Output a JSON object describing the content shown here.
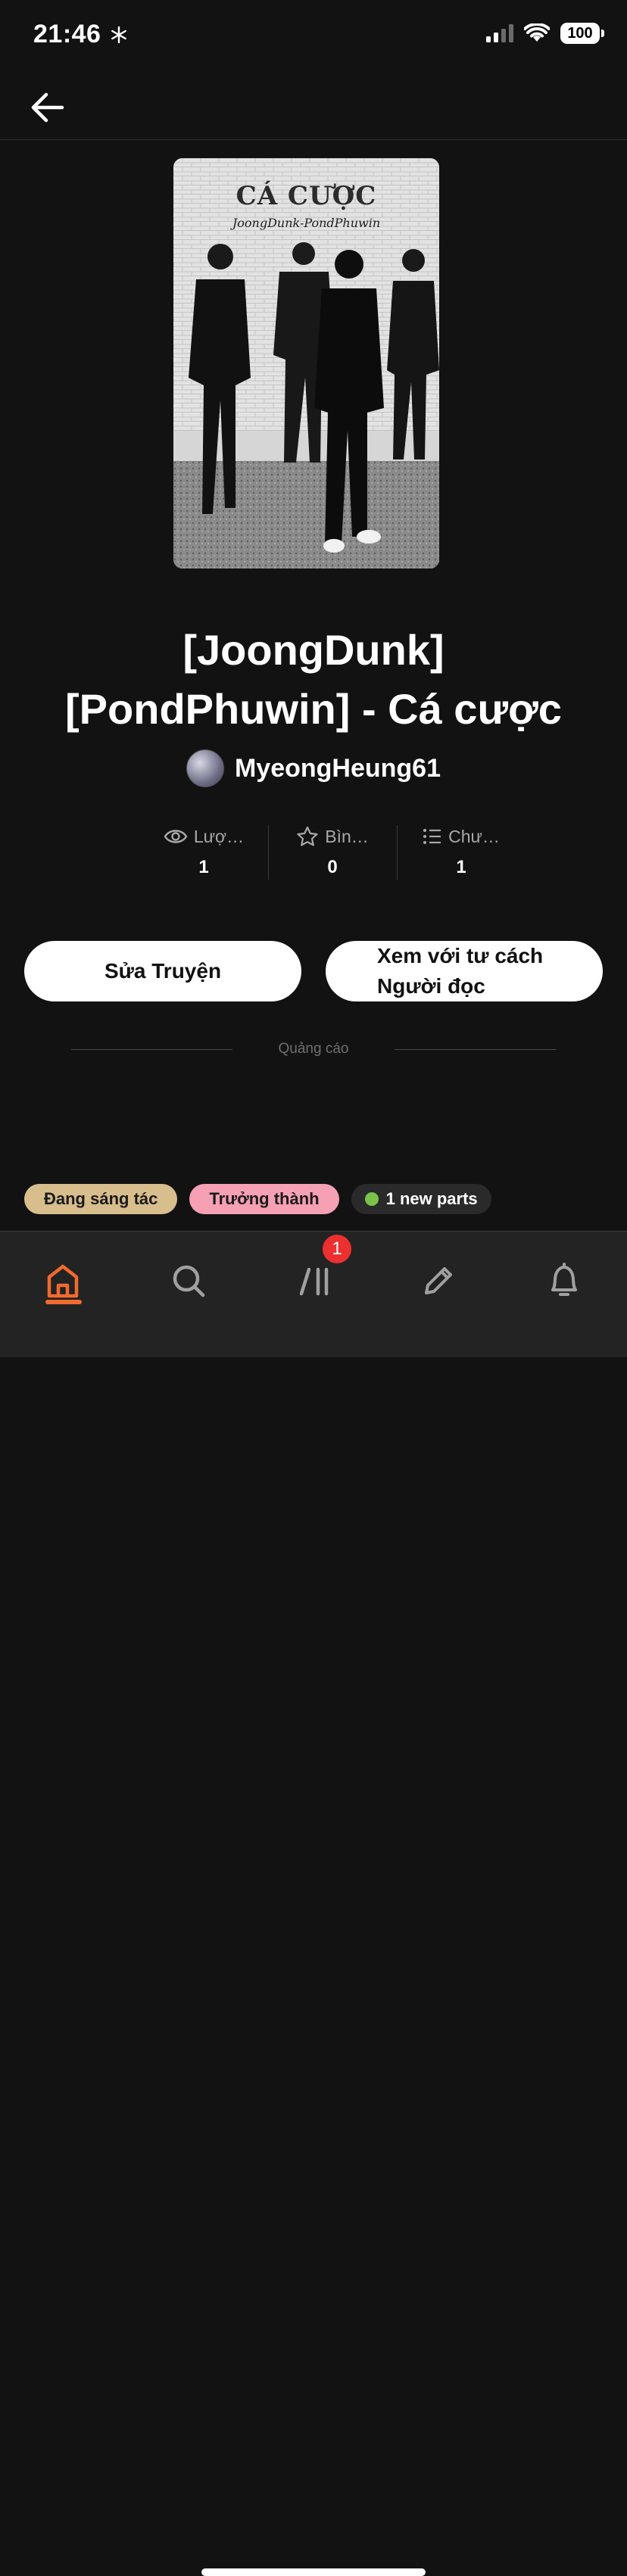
{
  "status_bar": {
    "time": "21:46",
    "battery": "100"
  },
  "cover": {
    "title": "CÁ CƯỢC",
    "subtitle": "JoongDunk-PondPhuwin"
  },
  "story": {
    "title_line1": "[JoongDunk]",
    "title_line2": "[PondPhuwin] - Cá cược",
    "author": "MyeongHeung61"
  },
  "stats": [
    {
      "label": "Lượ…",
      "value": "1",
      "icon": "eye-icon"
    },
    {
      "label": "Bìn…",
      "value": "0",
      "icon": "star-icon"
    },
    {
      "label": "Chư…",
      "value": "1",
      "icon": "list-icon"
    }
  ],
  "actions": {
    "edit_label": "Sửa Truyện",
    "reader_line1": "Xem với tư cách",
    "reader_line2": "Người đọc"
  },
  "ad_label": "Quảng cáo",
  "tags": {
    "status": "Đang sáng tác",
    "mature": "Trưởng thành",
    "new_parts": "1 new parts"
  },
  "tab_bar": {
    "library_badge": "1",
    "active_tab": "home",
    "accent": "#f26a2e"
  }
}
